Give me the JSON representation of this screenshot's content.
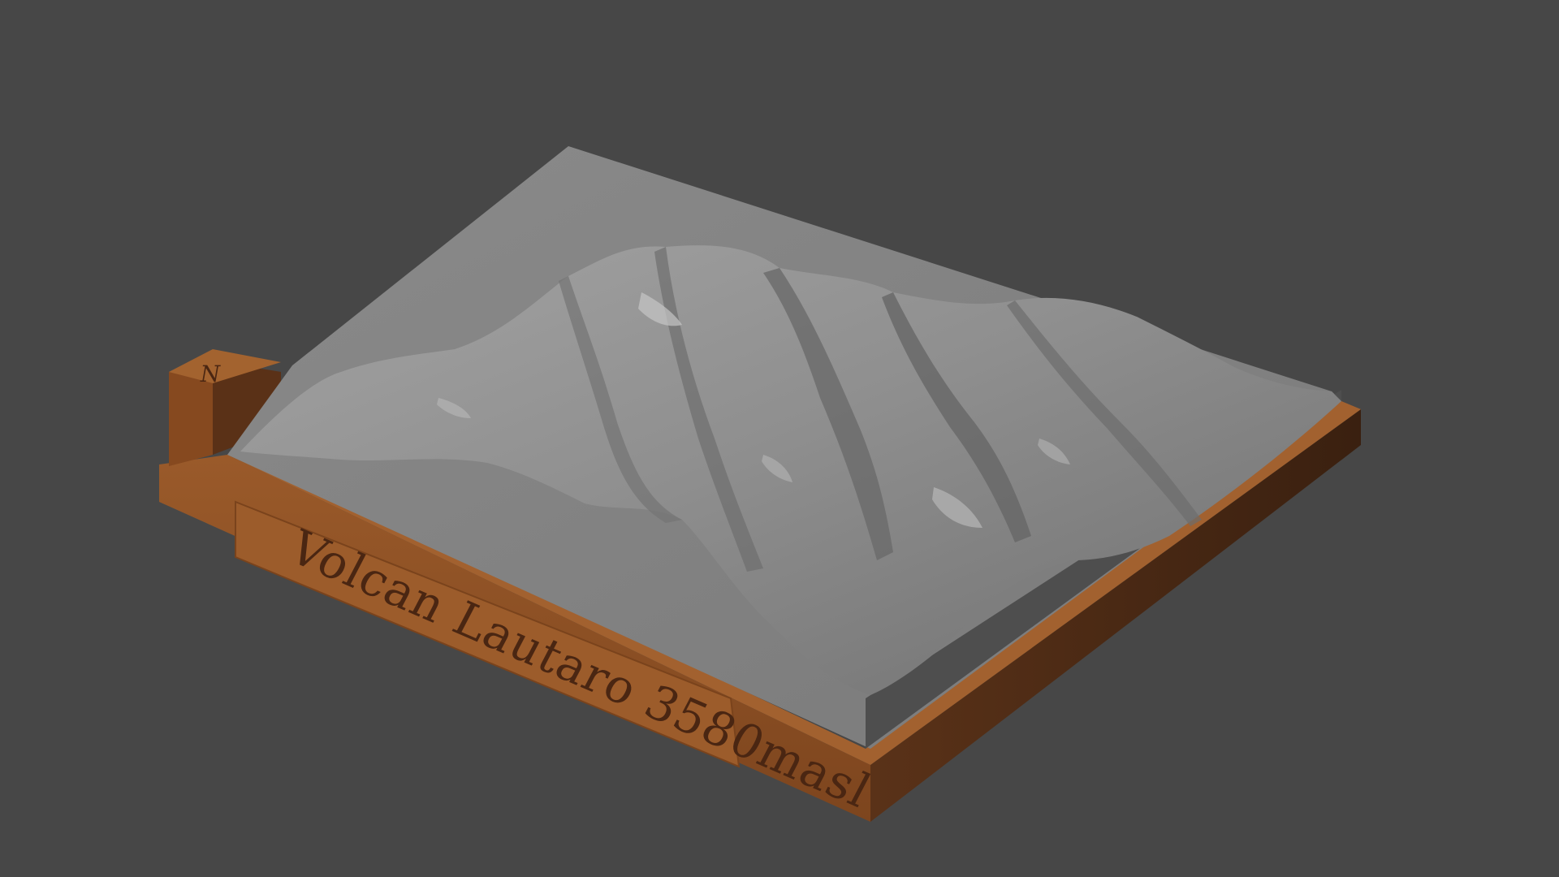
{
  "scene": {
    "background_color": "#474747",
    "terrain_color": "#8c8c8c",
    "base_color": "#8b4e24",
    "base_shadow_color": "#3e2414",
    "plaque": {
      "label": "Volcan Lautaro 3580masl"
    },
    "north_marker": {
      "label": "N"
    }
  }
}
